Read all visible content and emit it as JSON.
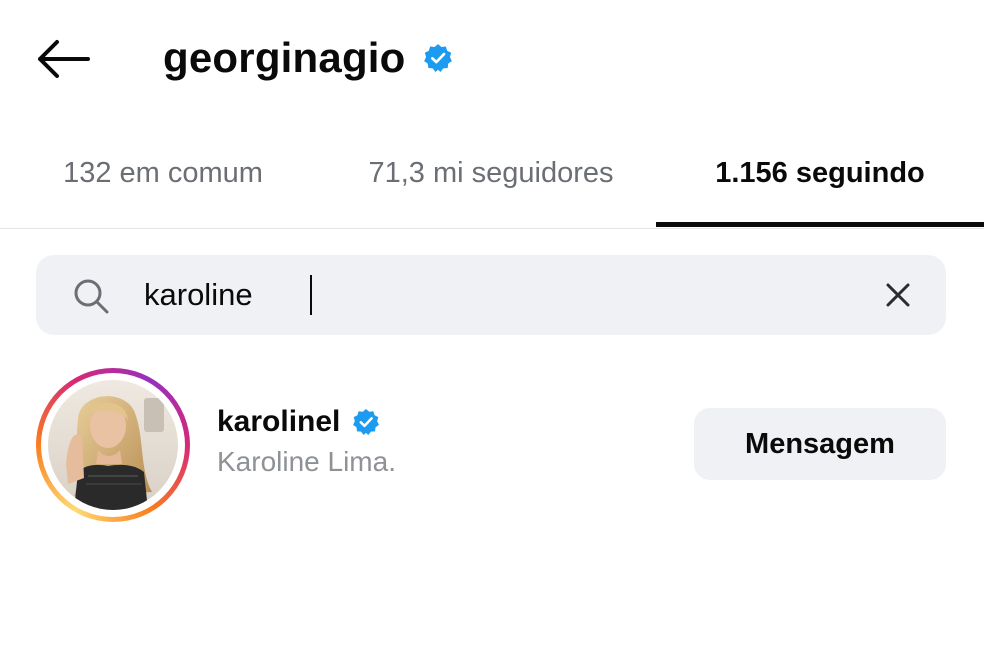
{
  "header": {
    "title": "georginagio",
    "verified": true,
    "back_icon": "arrow-left-icon"
  },
  "tabs": [
    {
      "label": "132 em comum",
      "active": false
    },
    {
      "label": "71,3 mi seguidores",
      "active": false
    },
    {
      "label": "1.156 seguindo",
      "active": true
    }
  ],
  "search": {
    "value": "karoline",
    "icon": "search-icon",
    "clear_icon": "close-icon"
  },
  "results": [
    {
      "username": "karolinel",
      "verified": true,
      "full_name": "Karoline Lima.",
      "has_story": true,
      "action_label": "Mensagem"
    }
  ],
  "colors": {
    "verified_blue": "#1d9bf0",
    "text_primary": "#0a0a0a",
    "text_secondary": "#6b6f74",
    "surface": "#eff1f4",
    "story_ring_start": "#feda75",
    "story_ring_end": "#962fbf"
  }
}
